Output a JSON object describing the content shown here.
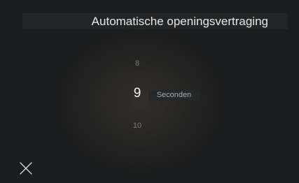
{
  "header": {
    "title": "Automatische openingsvertraging"
  },
  "picker": {
    "previous_value": "8",
    "selected_value": "9",
    "next_value": "10",
    "unit_label": "Seconden"
  },
  "icons": {
    "close": "close-icon"
  },
  "colors": {
    "background": "#1b1c1d",
    "title_text": "#e6e6e6",
    "selected_text": "#f4f4f4",
    "dim_text": "#7a7b7c"
  }
}
